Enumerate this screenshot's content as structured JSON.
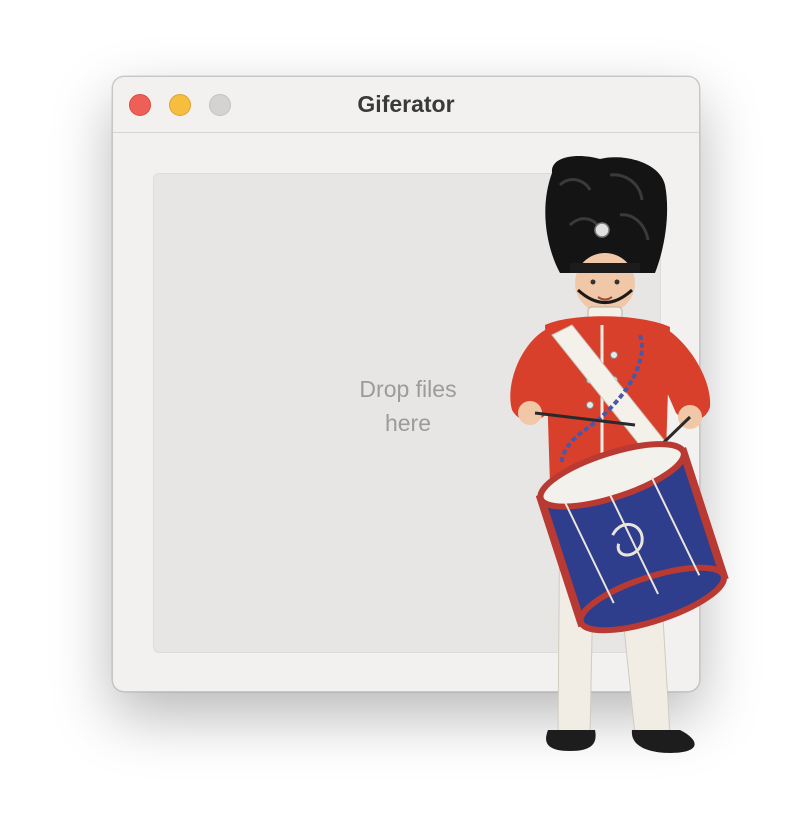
{
  "window": {
    "title": "Giferator"
  },
  "dropzone": {
    "label": "Drop files here"
  },
  "mascot": {
    "icon": "toy-soldier-drummer-icon"
  }
}
